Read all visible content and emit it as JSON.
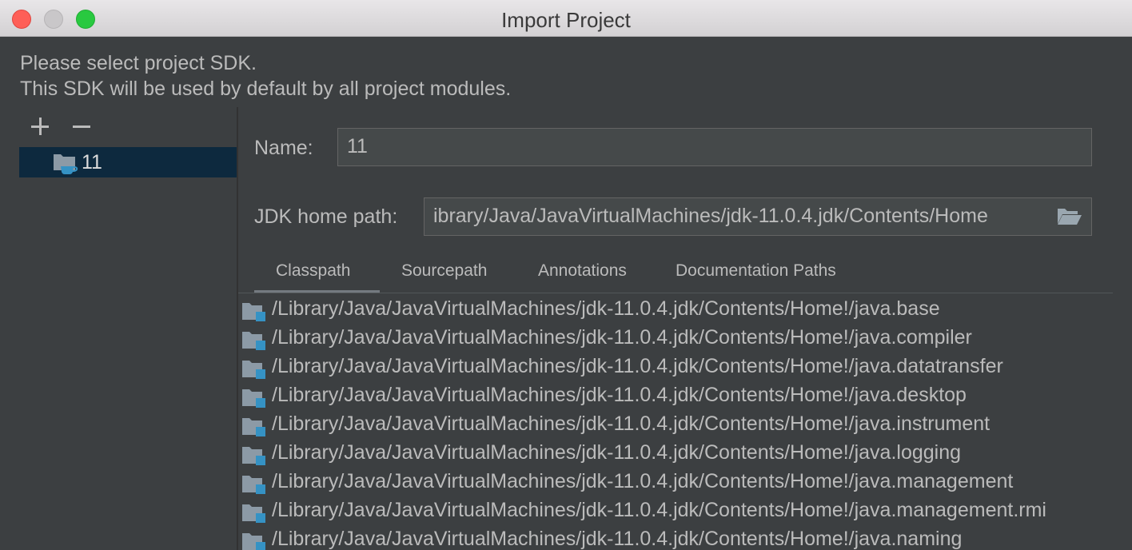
{
  "window": {
    "title": "Import Project"
  },
  "messages": {
    "line1": "Please select project SDK.",
    "line2": "This SDK will be used by default by all project modules."
  },
  "toolbar": {
    "add_icon": "plus-icon",
    "remove_icon": "minus-icon"
  },
  "sdk_list": {
    "items": [
      {
        "label": "11",
        "icon": "jdk-folder-icon"
      }
    ]
  },
  "form": {
    "name_label": "Name:",
    "name_value": "11",
    "jdk_label": "JDK home path:",
    "jdk_value": "ibrary/Java/JavaVirtualMachines/jdk-11.0.4.jdk/Contents/Home",
    "browse_icon": "folder-open-icon"
  },
  "tabs": [
    {
      "label": "Classpath",
      "selected": true
    },
    {
      "label": "Sourcepath",
      "selected": false
    },
    {
      "label": "Annotations",
      "selected": false
    },
    {
      "label": "Documentation Paths",
      "selected": false
    }
  ],
  "classpath": [
    "/Library/Java/JavaVirtualMachines/jdk-11.0.4.jdk/Contents/Home!/java.base",
    "/Library/Java/JavaVirtualMachines/jdk-11.0.4.jdk/Contents/Home!/java.compiler",
    "/Library/Java/JavaVirtualMachines/jdk-11.0.4.jdk/Contents/Home!/java.datatransfer",
    "/Library/Java/JavaVirtualMachines/jdk-11.0.4.jdk/Contents/Home!/java.desktop",
    "/Library/Java/JavaVirtualMachines/jdk-11.0.4.jdk/Contents/Home!/java.instrument",
    "/Library/Java/JavaVirtualMachines/jdk-11.0.4.jdk/Contents/Home!/java.logging",
    "/Library/Java/JavaVirtualMachines/jdk-11.0.4.jdk/Contents/Home!/java.management",
    "/Library/Java/JavaVirtualMachines/jdk-11.0.4.jdk/Contents/Home!/java.management.rmi",
    "/Library/Java/JavaVirtualMachines/jdk-11.0.4.jdk/Contents/Home!/java.naming"
  ],
  "colors": {
    "background": "#3c3f41",
    "selection": "#0d293e",
    "text": "#bbbbbb",
    "field": "#45494a",
    "module_badge": "#3592c4"
  }
}
